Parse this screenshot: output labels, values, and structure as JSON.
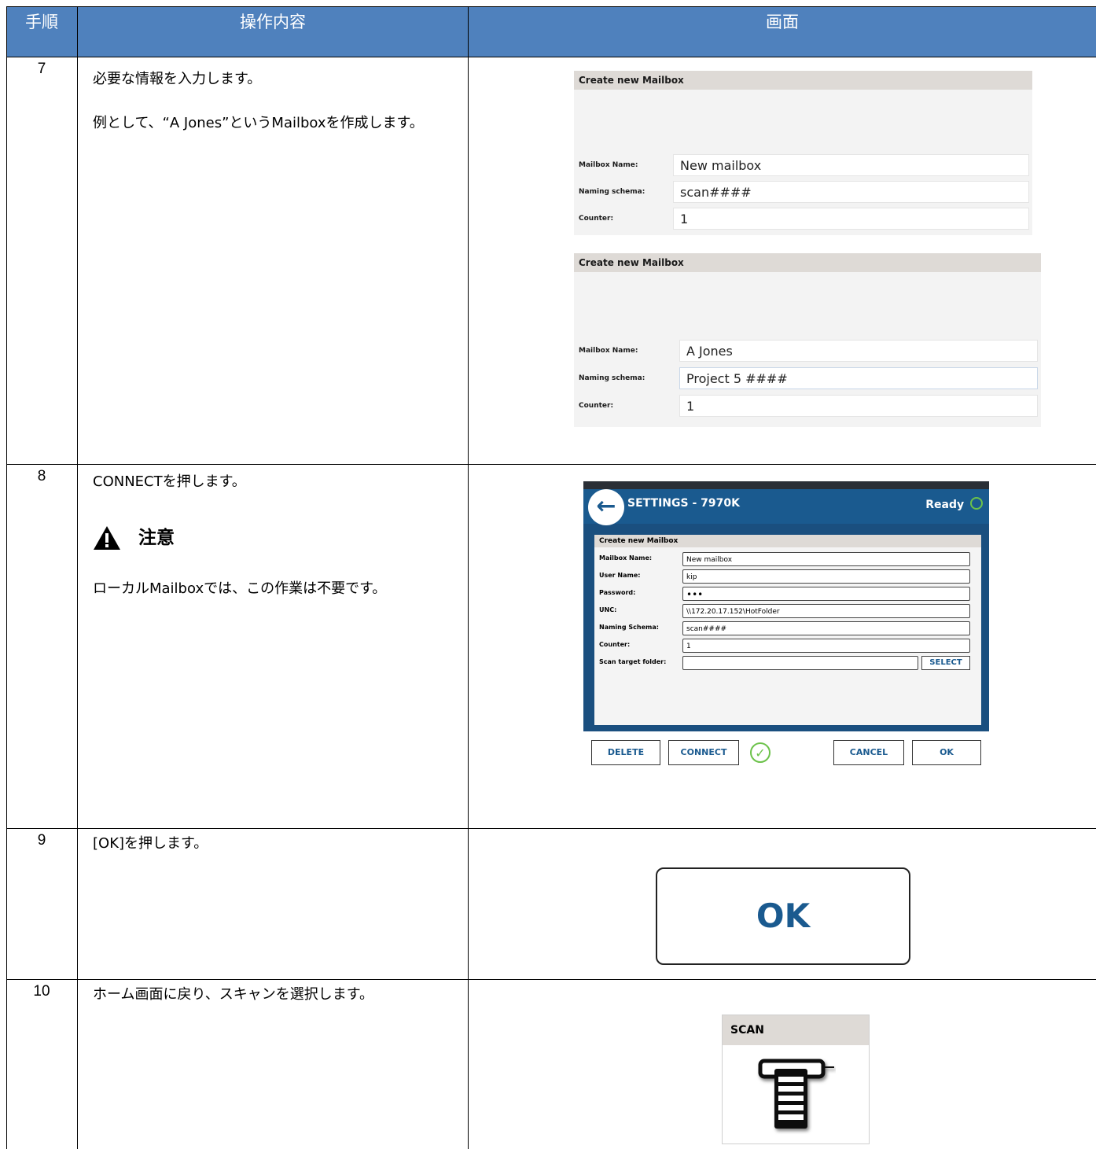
{
  "header": {
    "step": "手順",
    "operation": "操作内容",
    "screen": "画面"
  },
  "rows": [
    {
      "step": "7",
      "desc": [
        "必要な情報を入力します。",
        "例として、“A Jones”というMailboxを作成します。"
      ],
      "form1": {
        "title": "Create new Mailbox",
        "fields": [
          {
            "label": "Mailbox Name:",
            "value": "New mailbox"
          },
          {
            "label": "Naming schema:",
            "value": "scan####"
          },
          {
            "label": "Counter:",
            "value": "1"
          }
        ]
      },
      "form2": {
        "title": "Create new Mailbox",
        "fields": [
          {
            "label": "Mailbox Name:",
            "value": "A Jones"
          },
          {
            "label": "Naming schema:",
            "value": "Project 5 ####"
          },
          {
            "label": "Counter:",
            "value": "1"
          }
        ]
      }
    },
    {
      "step": "8",
      "desc": [
        "CONNECTを押します。"
      ],
      "caution_title": "注意",
      "caution_text": "ローカルMailboxでは、この作業は不要です。",
      "dialog": {
        "header_title": "SETTINGS - 7970K",
        "status": "Ready",
        "form_title": "Create new Mailbox",
        "fields": [
          {
            "label": "Mailbox Name:",
            "value": "New mailbox"
          },
          {
            "label": "User Name:",
            "value": "kip"
          },
          {
            "label": "Password:",
            "value": "•••"
          },
          {
            "label": "UNC:",
            "value": "\\\\172.20.17.152\\HotFolder"
          },
          {
            "label": "Naming Schema:",
            "value": "scan####"
          },
          {
            "label": "Counter:",
            "value": "1"
          },
          {
            "label": "Scan target folder:",
            "value": ""
          }
        ],
        "select_label": "SELECT",
        "buttons": {
          "delete": "DELETE",
          "connect": "CONNECT",
          "cancel": "CANCEL",
          "ok": "OK"
        }
      }
    },
    {
      "step": "9",
      "desc": [
        "[OK]を押します。"
      ],
      "ok_label": "OK"
    },
    {
      "step": "10",
      "desc": [
        "ホーム画面に戻り、スキャンを選択します。"
      ],
      "scan_label": "SCAN"
    }
  ],
  "colors": {
    "header_bg": "#4f81bd",
    "dialog_blue": "#1a5a8f",
    "check_green": "#6cc24a"
  },
  "icons": [
    "warning-icon",
    "back-arrow-icon",
    "ready-status-icon",
    "check-circle-icon",
    "scanner-icon"
  ]
}
